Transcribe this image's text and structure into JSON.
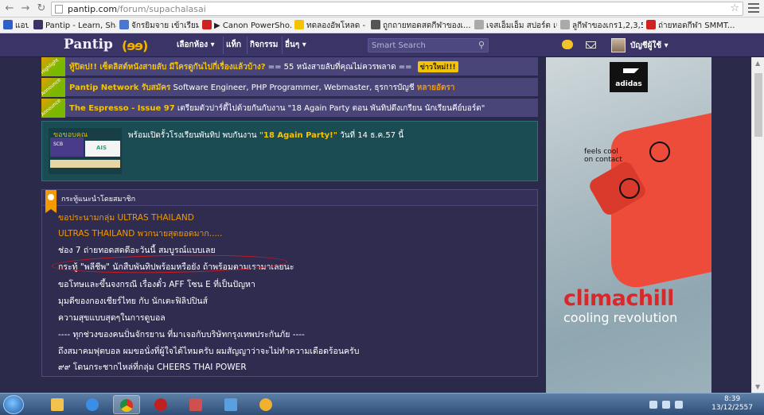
{
  "browser": {
    "url_host": "pantip.com",
    "url_path": "/forum/supachalasai",
    "bookmarks": [
      {
        "label": "แอป",
        "color": "#2f5fc9"
      },
      {
        "label": "Pantip - Learn, Shar...",
        "color": "#3a3566"
      },
      {
        "label": "จักรยิมจาย เข้าเรียมชัน...",
        "color": "#4a78d0"
      },
      {
        "label": "▶ Canon PowerSho...",
        "color": "#d02020"
      },
      {
        "label": "ทดลองอัพโหลด - Vi...",
        "color": "#f5c400"
      },
      {
        "label": "ถูกถายทอดสดกีฬาของเ...",
        "color": "#555"
      },
      {
        "label": "เจสเอ็มเอ็ม สปอร์ต เจ...",
        "color": "#aaa"
      },
      {
        "label": "ลูกีฬาของเกร1,2,3,5,6,7",
        "color": "#aaa"
      },
      {
        "label": "ถ่ายทอดกีฬา SMMT...",
        "color": "#d02020"
      }
    ]
  },
  "header": {
    "logo": "Pantip",
    "logo_mark": "(ɘɘ)",
    "nav": [
      "เลือกห้อง ▾",
      "แท็ก",
      "กิจกรรม",
      "อื่นๆ ▾"
    ],
    "search_placeholder": "Smart Search",
    "username": "บัญชีผู้ใช้ ▾"
  },
  "announcements": [
    {
      "tag": "Highlight",
      "pre": "ทู้ปิดป!! เซ็ตลิสต์หนังสายลับ มีใครดูกันไปกี่เรื่องแล้วบ้าง?",
      "mid": " == 55 หนังสายลับที่คุณไม่ควรพลาด == ",
      "badge": "ข่าวใหม่!!!"
    },
    {
      "tag": "Announce",
      "pre": "Pantip Network รับสมัคร",
      "mid": " Software Engineer, PHP Programmer, Webmaster, ธุรการบัญชี ",
      "post": "หลายอัตรา"
    },
    {
      "tag": "Announce",
      "pre": "The Espresso - Issue 97",
      "mid": " เตรียมตัวปาร์ตี้ไปด้วยกันกับงาน \"18 Again Party ตอน พันทิปดึงเกรียน นักเรียนคีย์บอร์ด\""
    }
  ],
  "promo": {
    "img_title": "ขอขอบคุณ",
    "sponsor_a": "SCB",
    "sponsor_b": "AIS",
    "pre": "พร้อมเปิดรั้วโรงเรียนพันทิป พบกันงาน ",
    "highlight": "\"18 Again Party!\"",
    "post": " วันที่ 14 ธ.ค.57 นี้"
  },
  "recommend": {
    "title": "กระทู้แนะนำโดยสมาชิก",
    "items": [
      {
        "text": "ขอประนามกลุ่ม ULTRAS THAILAND",
        "style": "orange"
      },
      {
        "text": "ULTRAS THAILAND พวกนายสุดยอดมาก.....",
        "style": "orange"
      },
      {
        "text": "ช่อง 7 ถ่ายทอดสดดีอะวันนี้ สมบูรณ์แบบเลย",
        "style": "white"
      },
      {
        "text": "กระทู้ \"พลีชีพ\" นักสืบพันทิปพร้อมหรือยัง ถ้าพร้อมตามเรามาเลยนะ",
        "style": "hl"
      },
      {
        "text": "ขอโทษและขึ้นจงกรณี เรื่องตั๋ว AFF โซน E ที่เป็นปัญหา",
        "style": "white"
      },
      {
        "text": "มุมดีของกองเชียร์ไทย กับ นักเตะฟิลิปปินส์",
        "style": "white"
      },
      {
        "text": "ความสุขแบบสุดๆในการดูบอล",
        "style": "white"
      },
      {
        "text": "---- ทุกช่วงของคนปั่นจักรยาน ที่มาเจอกับบริษัทกรุงเทพประกันภัย ----",
        "style": "white"
      },
      {
        "text": "ถึงสมาคมฟุตบอล ผมขอนั่งที่ผู้ใจได้ไหมครับ ผมสัญญาว่าจะไม่ทำความเดือดร้อนครับ",
        "style": "white"
      },
      {
        "text": "๙๙ โดนกระชากไหล่ที่กลุ่ม CHEERS THAI POWER",
        "style": "white"
      }
    ]
  },
  "ad": {
    "brand": "adidas",
    "copy_line1": "feels cool",
    "copy_line2": "on contact",
    "headline": "climachill",
    "tagline": "cooling revolution"
  },
  "taskbar": {
    "time": "8:39",
    "date": "13/12/2557"
  }
}
